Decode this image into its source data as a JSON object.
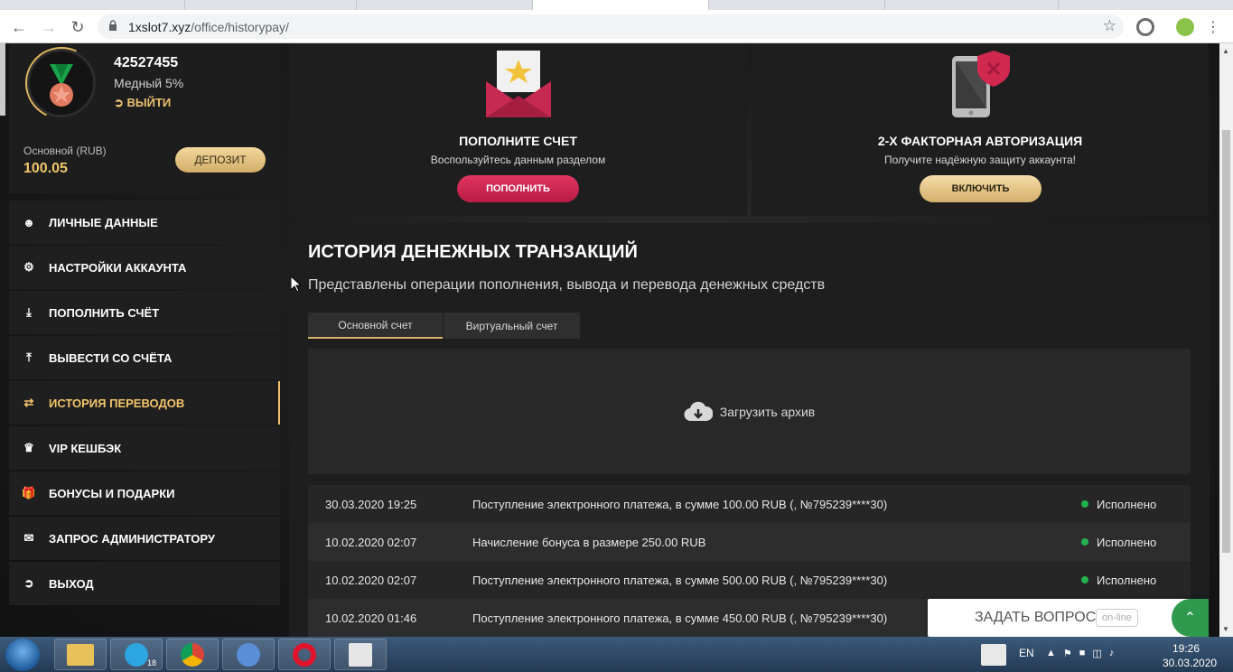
{
  "browser": {
    "url_domain": "1xslot7.xyz",
    "url_path": "/office/historypay/"
  },
  "profile": {
    "user_id": "42527455",
    "level": "Медный 5%",
    "logout_label": "ВЫЙТИ",
    "balance_label": "Основной (RUB)",
    "balance_value": "100.05",
    "deposit_label": "ДЕПОЗИТ"
  },
  "menu": {
    "items": [
      {
        "label": "ЛИЧНЫЕ ДАННЫЕ",
        "icon": "user-gear-icon"
      },
      {
        "label": "НАСТРОЙКИ АККАУНТА",
        "icon": "gears-icon"
      },
      {
        "label": "ПОПОЛНИТЬ СЧЁТ",
        "icon": "download-icon"
      },
      {
        "label": "ВЫВЕСТИ СО СЧЁТА",
        "icon": "upload-icon"
      },
      {
        "label": "ИСТОРИЯ ПЕРЕВОДОВ",
        "icon": "transfer-arrows-icon",
        "active": true
      },
      {
        "label": "VIP КЕШБЭК",
        "icon": "crown-icon"
      },
      {
        "label": "БОНУСЫ И ПОДАРКИ",
        "icon": "gift-icon"
      },
      {
        "label": "ЗАПРОС АДМИНИСТРАТОРУ",
        "icon": "envelope-icon"
      },
      {
        "label": "ВЫХОД",
        "icon": "exit-icon"
      }
    ]
  },
  "cards": {
    "deposit": {
      "title": "ПОПОЛНИТЕ СЧЕТ",
      "subtitle": "Воспользуйтесь данным разделом",
      "button": "ПОПОЛНИТЬ"
    },
    "twofa": {
      "title": "2-Х ФАКТОРНАЯ АВТОРИЗАЦИЯ",
      "subtitle": "Получите надёжную защиту аккаунта!",
      "button": "ВКЛЮЧИТЬ"
    }
  },
  "history": {
    "title": "ИСТОРИЯ ДЕНЕЖНЫХ ТРАНЗАКЦИЙ",
    "subtitle": "Представлены операции пополнения, вывода и перевода денежных средств",
    "tabs": [
      "Основной счет",
      "Виртуальный счет"
    ],
    "archive_label": "Загрузить архив",
    "transactions": [
      {
        "date": "30.03.2020 19:25",
        "description": "Поступление электронного платежа, в сумме 100.00 RUB (, №795239****30)",
        "status": "Исполнено"
      },
      {
        "date": "10.02.2020 02:07",
        "description": "Начисление бонуса в размере 250.00 RUB",
        "status": "Исполнено"
      },
      {
        "date": "10.02.2020 02:07",
        "description": "Поступление электронного платежа, в сумме 500.00 RUB (, №795239****30)",
        "status": "Исполнено"
      },
      {
        "date": "10.02.2020 01:46",
        "description": "Поступление электронного платежа, в сумме 450.00 RUB (, №795239****30)",
        "status": ""
      }
    ]
  },
  "chat": {
    "label": "ЗАДАТЬ ВОПРОС",
    "badge": "on-line"
  },
  "taskbar": {
    "telegram_badge": "18",
    "lang": "EN",
    "time": "19:26",
    "date": "30.03.2020"
  },
  "colors": {
    "accent_gold": "#f2c56a",
    "accent_pink": "#d0284f",
    "status_green": "#22b14c"
  }
}
